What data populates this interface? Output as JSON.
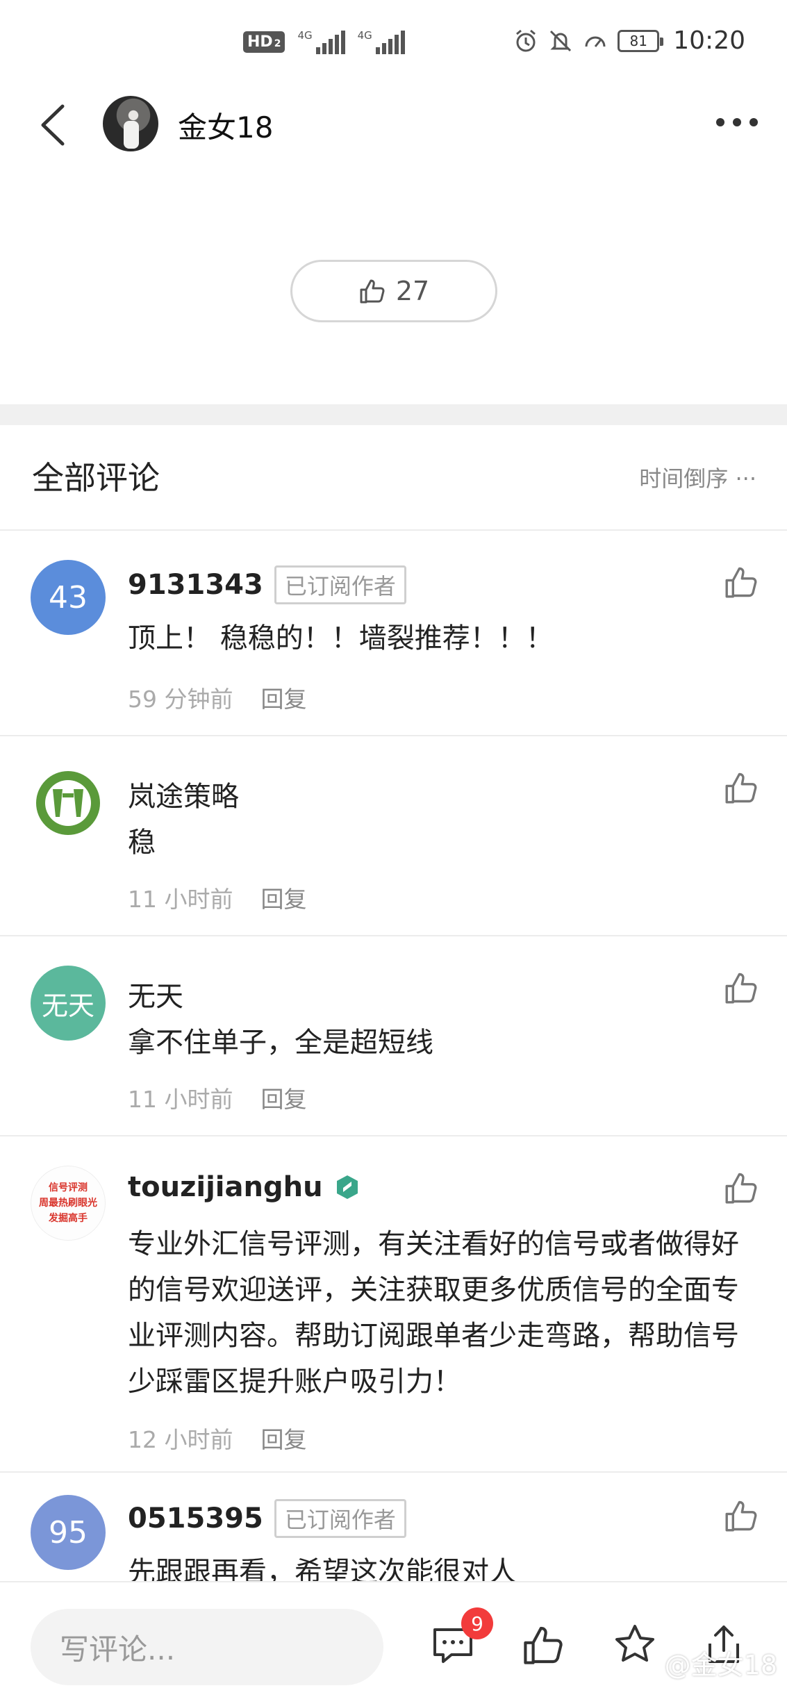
{
  "status_bar": {
    "hd": "HD",
    "hd_sub": "2",
    "sim1_label": "4G",
    "sim2_label": "4G",
    "battery": "81",
    "time": "10:20"
  },
  "header": {
    "author": "金女18"
  },
  "like_pill": {
    "count": "27"
  },
  "comments_header": {
    "title": "全部评论",
    "sort": "时间倒序 ···"
  },
  "comments": [
    {
      "avatar_text": "43",
      "avatar_color": "#5b8ddb",
      "name": "9131343",
      "tag": "已订阅作者",
      "text": "顶上！ 稳稳的！！墙裂推荐！！！",
      "time": "59 分钟前",
      "reply": "回复"
    },
    {
      "avatar_text": "",
      "avatar_color": "#5a9a3a",
      "name": "岚途策略",
      "tag": "",
      "text": "稳",
      "time": "11 小时前",
      "reply": "回复"
    },
    {
      "avatar_text": "无天",
      "avatar_color": "#5bb89c",
      "name": "无天",
      "tag": "",
      "text": "拿不住单子，全是超短线",
      "time": "11 小时前",
      "reply": "回复"
    },
    {
      "avatar_lines": [
        "信号评测",
        "周最热刷眼光",
        "发掘高手"
      ],
      "avatar_color": "#fdfdfd",
      "name": "touzijianghu",
      "tag": "",
      "text": "专业外汇信号评测，有关注看好的信号或者做得好的信号欢迎送评，关注获取更多优质信号的全面专业评测内容。帮助订阅跟单者少走弯路，帮助信号少踩雷区提升账户吸引力！",
      "time": "12 小时前",
      "reply": "回复"
    },
    {
      "avatar_text": "95",
      "avatar_color": "#7b96d8",
      "name": "0515395",
      "tag": "已订阅作者",
      "text": "先跟跟再看，希望这次能很对人",
      "time": "",
      "reply": ""
    }
  ],
  "bottom_bar": {
    "input_placeholder": "写评论...",
    "comment_badge": "9",
    "watermark": "@金女18"
  }
}
